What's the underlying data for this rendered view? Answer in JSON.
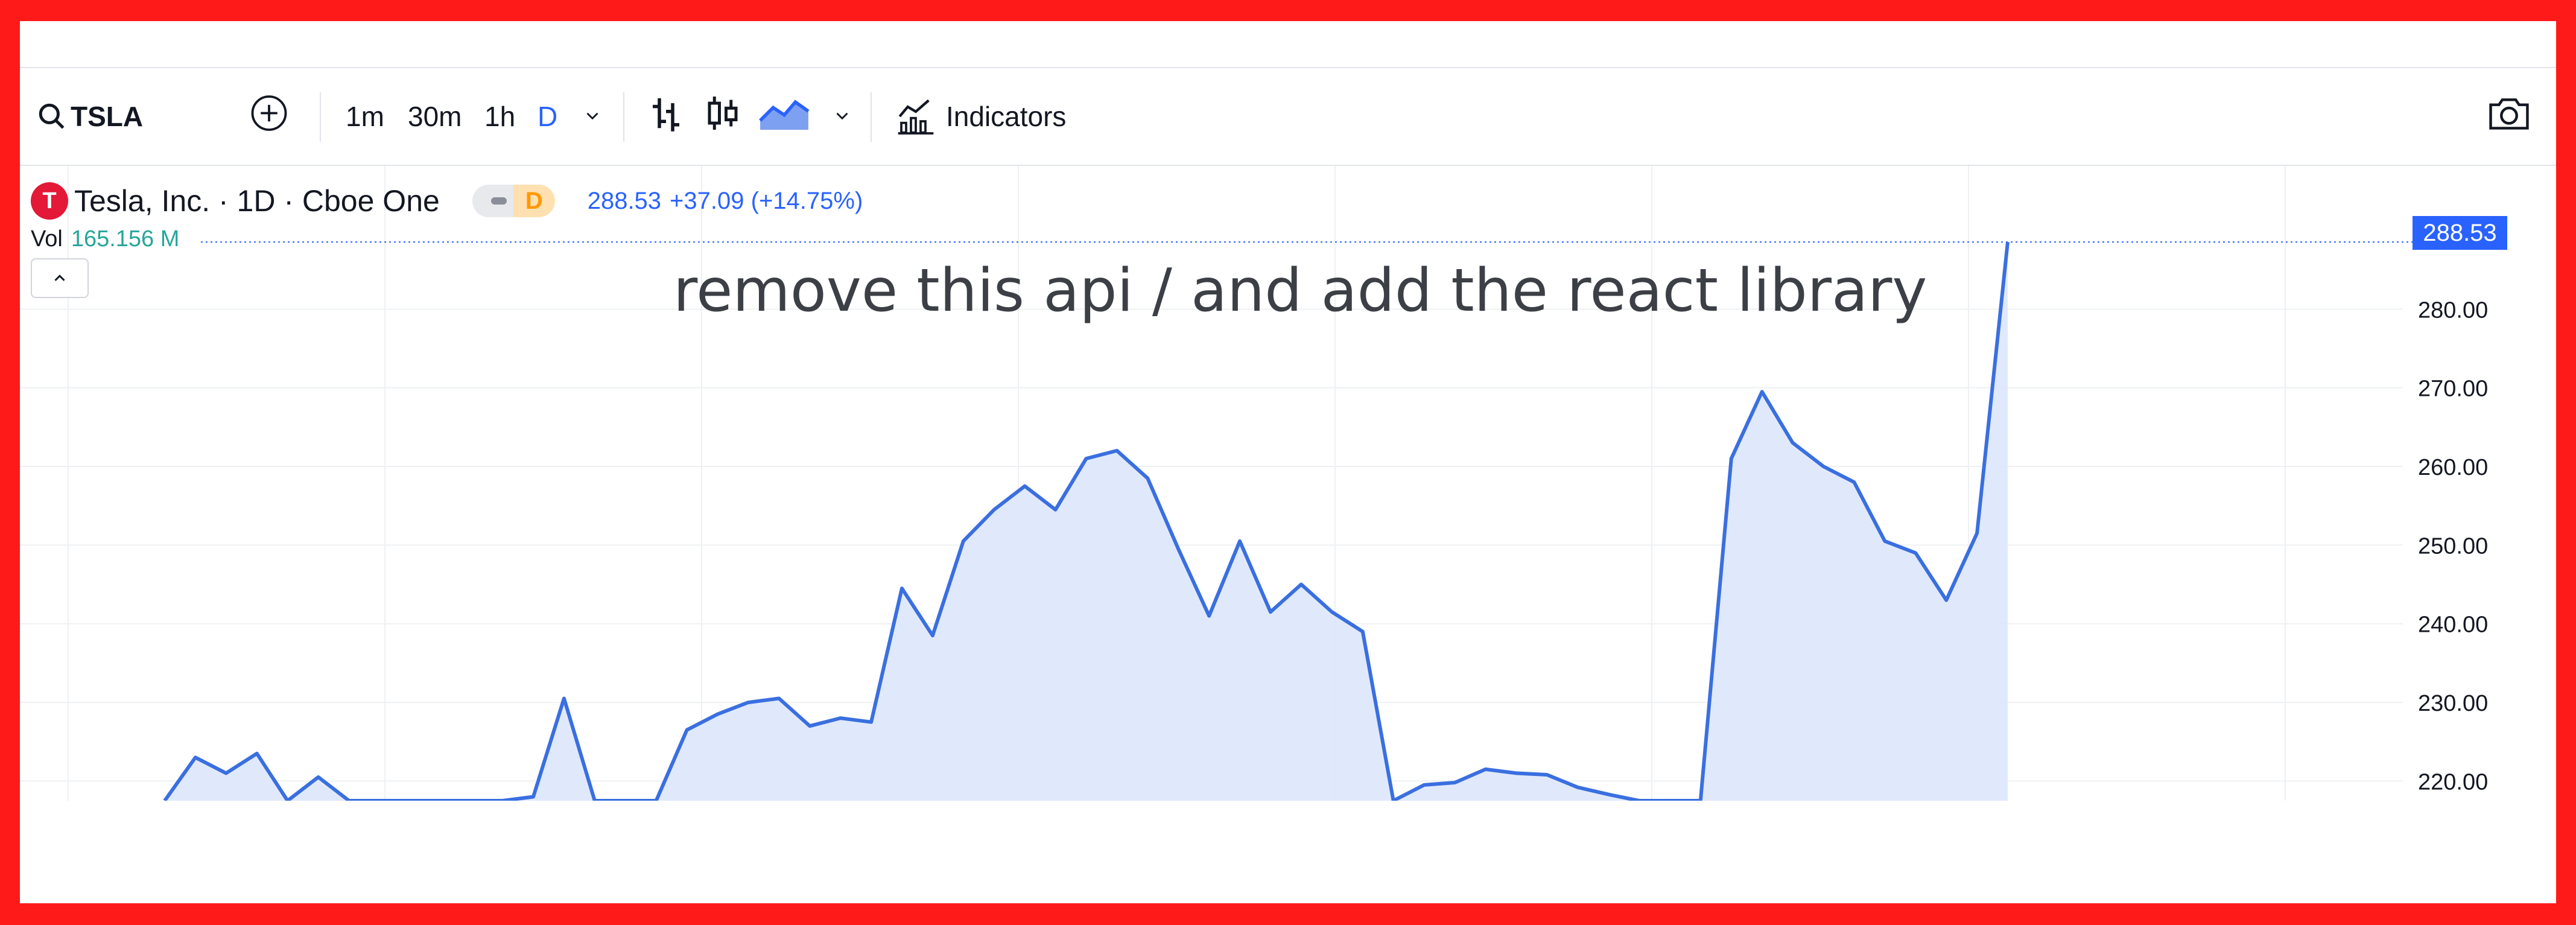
{
  "toolbar": {
    "symbol": "TSLA",
    "intervals": [
      "1m",
      "30m",
      "1h",
      "D"
    ],
    "indicators_label": "Indicators"
  },
  "legend": {
    "title": "Tesla, Inc. · 1D · Cboe One",
    "market_badge": "D",
    "price": "288.53",
    "change": "+37.09 (+14.75%)",
    "vol_label": "Vol",
    "vol_value": "165.156 M"
  },
  "annotation": "remove this api / and add the react library",
  "price_badge": "288.53",
  "colors": {
    "line": "#3a6fe0",
    "fill": "#dbe5fb",
    "accent": "#2962ff",
    "volume": "#26a69a",
    "border": "#ff1a1a"
  },
  "chart_data": {
    "type": "area",
    "ylim": [
      217.5,
      289
    ],
    "y_ticks": [
      "220.00",
      "230.00",
      "240.00",
      "250.00",
      "260.00",
      "270.00",
      "280.00"
    ],
    "values": [
      215,
      223,
      221,
      223.5,
      216,
      220.5,
      214,
      213,
      211,
      212,
      210,
      214.5,
      218,
      230.5,
      214,
      212,
      216,
      226.5,
      228.5,
      230,
      230.5,
      227,
      228,
      227.5,
      244.5,
      238.5,
      250.5,
      254.5,
      257.5,
      254.5,
      261,
      262,
      258.5,
      249.5,
      241,
      250.5,
      241.5,
      245,
      241.5,
      239,
      217.5,
      219.5,
      219.8,
      221.5,
      221,
      220.8,
      219.2,
      218.3,
      215,
      213,
      217,
      261,
      269.5,
      263,
      260,
      258,
      250.5,
      249,
      243,
      251.5,
      288.53
    ],
    "last_price": 288.53
  }
}
